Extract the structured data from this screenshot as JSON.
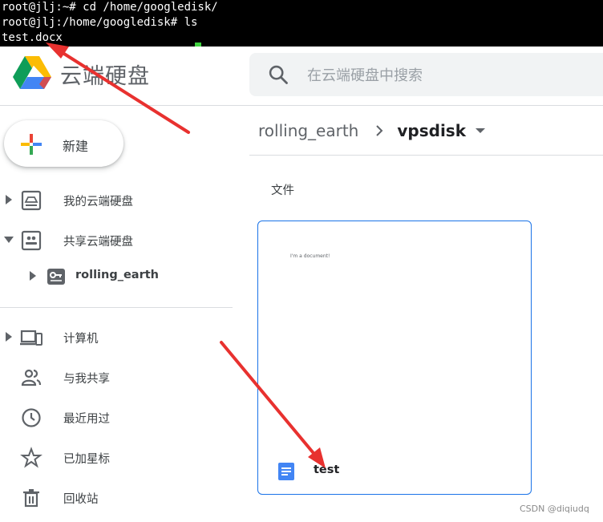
{
  "terminal": {
    "lines": [
      "root@jlj:~# cd /home/googledisk/",
      "root@jlj:/home/googledisk# ls",
      "test.docx"
    ]
  },
  "header": {
    "brand": "云端硬盘",
    "search_placeholder": "在云端硬盘中搜索",
    "search_value": ""
  },
  "sidebar": {
    "new_label": "新建",
    "my_drive": "我的云端硬盘",
    "shared_drives": "共享云端硬盘",
    "shared_child": "rolling_earth",
    "computers": "计算机",
    "shared_with_me": "与我共享",
    "recent": "最近用过",
    "starred": "已加星标",
    "trash": "回收站"
  },
  "main": {
    "breadcrumb_parent": "rolling_earth",
    "breadcrumb_current": "vpsdisk",
    "section_label": "文件",
    "file": {
      "preview_text": "I'm a document!",
      "name": "test"
    }
  },
  "watermark": "CSDN @diqiudq",
  "colors": {
    "accent": "#1a73e8",
    "annotation": "#e8312f",
    "terminal_bg": "#000000"
  }
}
